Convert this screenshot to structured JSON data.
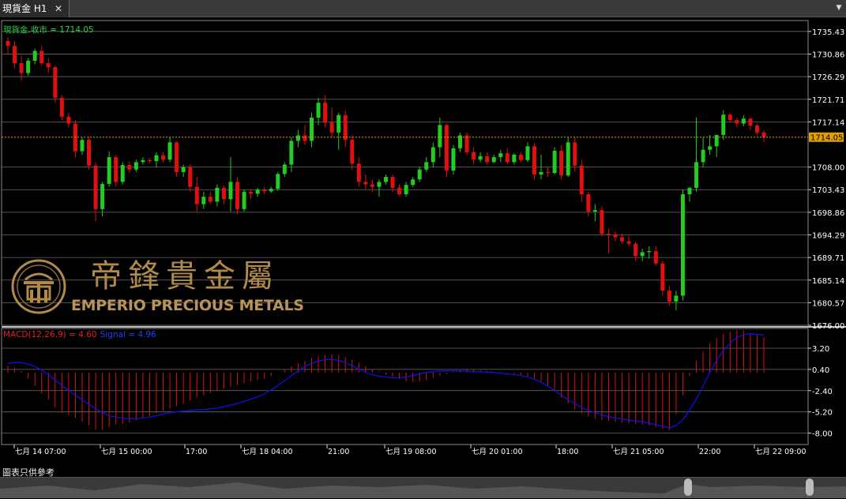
{
  "window": {
    "tab_title": "現貨金 H1",
    "close_glyph": "✕",
    "menu_glyph": "▼"
  },
  "price_panel": {
    "symbol_label": "現貨金,收市 = 1714.05",
    "current_price": "1714.05",
    "y_ticks": [
      "1735.43",
      "1730.86",
      "1726.29",
      "1721.71",
      "1717.14",
      "1708.00",
      "1703.43",
      "1698.86",
      "1694.29",
      "1689.71",
      "1685.14",
      "1680.57",
      "1676.00"
    ]
  },
  "macd_panel": {
    "macd_label": "MACD(12,26,9) = 4.60",
    "signal_label": "Signal = 4.96",
    "y_ticks": [
      "3.20",
      "0.40",
      "-2.40",
      "-5.20",
      "-8.00"
    ]
  },
  "x_ticks": [
    "七月 14 07:00",
    "七月 15 00:00",
    "17:00",
    "七月 18 04:00",
    "21:00",
    "七月 19 08:00",
    "七月 20 01:00",
    "18:00",
    "七月 21 05:00",
    "22:00",
    "七月 22 09:00"
  ],
  "logo": {
    "cn": "帝鋒貴金屬",
    "en": "EMPERIO PRECIOUS METALS"
  },
  "footer": {
    "label": "圖表只供參考"
  },
  "colors": {
    "up": "#22cc22",
    "down": "#e01010",
    "grid": "#6b6b6b",
    "axis_text": "#ffffff",
    "price_line": "#e0a000",
    "signal": "#1010e0",
    "hist": "#e01010",
    "logo_gold": "#b08a4a"
  },
  "chart_data": {
    "type": "candlestick",
    "title": "現貨金 H1",
    "close": 1714.05,
    "ylim": [
      1676.0,
      1737.0
    ],
    "candles": [
      [
        1733.5,
        1734.2,
        1731.0,
        1732.5
      ],
      [
        1732.5,
        1733.5,
        1728.0,
        1729.0
      ],
      [
        1729.0,
        1730.5,
        1725.5,
        1727.0
      ],
      [
        1727.0,
        1730.0,
        1726.5,
        1729.5
      ],
      [
        1729.5,
        1732.0,
        1728.8,
        1731.5
      ],
      [
        1731.5,
        1732.5,
        1728.5,
        1729.0
      ],
      [
        1729.0,
        1730.0,
        1727.0,
        1728.2
      ],
      [
        1728.2,
        1728.5,
        1721.0,
        1722.0
      ],
      [
        1722.0,
        1722.5,
        1717.5,
        1718.2
      ],
      [
        1718.2,
        1719.0,
        1716.0,
        1716.8
      ],
      [
        1716.8,
        1717.5,
        1710.0,
        1711.2
      ],
      [
        1711.2,
        1714.0,
        1710.5,
        1713.5
      ],
      [
        1713.5,
        1714.2,
        1707.5,
        1708.3
      ],
      [
        1708.3,
        1709.0,
        1697.0,
        1699.5
      ],
      [
        1699.5,
        1705.0,
        1698.0,
        1704.6
      ],
      [
        1704.6,
        1711.2,
        1704.0,
        1710.0
      ],
      [
        1710.0,
        1710.5,
        1704.0,
        1705.0
      ],
      [
        1705.0,
        1709.0,
        1704.5,
        1708.4
      ],
      [
        1708.4,
        1709.2,
        1706.8,
        1707.5
      ],
      [
        1707.5,
        1709.5,
        1707.0,
        1709.0
      ],
      [
        1709.0,
        1710.0,
        1708.5,
        1709.4
      ],
      [
        1709.4,
        1709.8,
        1708.8,
        1709.2
      ],
      [
        1709.2,
        1711.0,
        1708.0,
        1710.4
      ],
      [
        1710.4,
        1711.0,
        1709.0,
        1709.5
      ],
      [
        1709.5,
        1714.0,
        1709.0,
        1713.0
      ],
      [
        1713.0,
        1713.2,
        1706.0,
        1707.0
      ],
      [
        1707.0,
        1708.5,
        1706.0,
        1708.0
      ],
      [
        1708.0,
        1708.5,
        1703.0,
        1704.0
      ],
      [
        1704.0,
        1706.0,
        1699.0,
        1700.5
      ],
      [
        1700.5,
        1703.0,
        1699.5,
        1702.0
      ],
      [
        1702.0,
        1703.0,
        1700.5,
        1701.0
      ],
      [
        1701.0,
        1704.5,
        1700.0,
        1703.8
      ],
      [
        1703.8,
        1704.2,
        1700.5,
        1701.5
      ],
      [
        1701.5,
        1710.0,
        1699.0,
        1705.0
      ],
      [
        1705.0,
        1706.0,
        1698.5,
        1699.5
      ],
      [
        1699.5,
        1703.5,
        1699.0,
        1703.0
      ],
      [
        1703.0,
        1703.6,
        1701.5,
        1702.6
      ],
      [
        1702.6,
        1703.8,
        1702.0,
        1703.4
      ],
      [
        1703.4,
        1704.0,
        1702.5,
        1703.1
      ],
      [
        1703.1,
        1704.0,
        1702.8,
        1703.6
      ],
      [
        1703.6,
        1707.0,
        1703.2,
        1706.6
      ],
      [
        1706.6,
        1709.0,
        1706.0,
        1708.5
      ],
      [
        1708.5,
        1714.0,
        1707.0,
        1713.3
      ],
      [
        1713.3,
        1715.5,
        1712.0,
        1714.4
      ],
      [
        1714.4,
        1716.5,
        1712.5,
        1713.3
      ],
      [
        1713.3,
        1719.0,
        1712.0,
        1718.0
      ],
      [
        1718.0,
        1722.0,
        1716.5,
        1721.0
      ],
      [
        1721.0,
        1722.5,
        1716.0,
        1717.0
      ],
      [
        1717.0,
        1720.0,
        1714.0,
        1715.0
      ],
      [
        1715.0,
        1719.0,
        1711.5,
        1718.5
      ],
      [
        1718.5,
        1719.5,
        1712.0,
        1713.5
      ],
      [
        1713.5,
        1714.5,
        1707.5,
        1708.7
      ],
      [
        1708.7,
        1710.0,
        1704.0,
        1705.0
      ],
      [
        1705.0,
        1706.5,
        1703.5,
        1704.5
      ],
      [
        1704.5,
        1705.5,
        1703.0,
        1704.0
      ],
      [
        1704.0,
        1705.5,
        1702.0,
        1705.0
      ],
      [
        1705.0,
        1706.5,
        1704.5,
        1706.0
      ],
      [
        1706.0,
        1706.5,
        1703.0,
        1703.8
      ],
      [
        1703.8,
        1704.5,
        1702.0,
        1702.5
      ],
      [
        1702.5,
        1705.0,
        1702.0,
        1704.4
      ],
      [
        1704.4,
        1706.0,
        1704.0,
        1705.5
      ],
      [
        1705.5,
        1708.0,
        1705.0,
        1707.5
      ],
      [
        1707.5,
        1710.0,
        1707.0,
        1709.0
      ],
      [
        1709.0,
        1713.0,
        1708.0,
        1712.0
      ],
      [
        1712.0,
        1718.0,
        1710.0,
        1716.5
      ],
      [
        1716.5,
        1716.8,
        1706.0,
        1707.3
      ],
      [
        1707.3,
        1712.5,
        1706.5,
        1711.8
      ],
      [
        1711.8,
        1715.0,
        1711.0,
        1714.4
      ],
      [
        1714.4,
        1715.0,
        1710.5,
        1711.0
      ],
      [
        1711.0,
        1712.0,
        1708.5,
        1709.5
      ],
      [
        1709.5,
        1711.0,
        1709.0,
        1710.2
      ],
      [
        1710.2,
        1711.0,
        1708.5,
        1709.0
      ],
      [
        1709.0,
        1710.5,
        1708.8,
        1710.0
      ],
      [
        1710.0,
        1711.5,
        1709.0,
        1710.8
      ],
      [
        1710.8,
        1711.8,
        1708.5,
        1709.0
      ],
      [
        1709.0,
        1710.8,
        1708.5,
        1710.5
      ],
      [
        1710.5,
        1711.0,
        1709.0,
        1709.4
      ],
      [
        1709.4,
        1713.0,
        1709.0,
        1712.2
      ],
      [
        1712.2,
        1712.8,
        1705.5,
        1706.5
      ],
      [
        1706.5,
        1710.5,
        1705.5,
        1707.0
      ],
      [
        1707.0,
        1708.0,
        1706.0,
        1706.8
      ],
      [
        1706.8,
        1712.0,
        1706.5,
        1711.3
      ],
      [
        1711.3,
        1712.5,
        1705.5,
        1706.3
      ],
      [
        1706.3,
        1714.0,
        1706.0,
        1713.0
      ],
      [
        1713.0,
        1714.0,
        1707.0,
        1708.3
      ],
      [
        1708.3,
        1709.5,
        1701.0,
        1702.5
      ],
      [
        1702.5,
        1703.0,
        1698.0,
        1699.0
      ],
      [
        1699.0,
        1700.5,
        1697.0,
        1699.3
      ],
      [
        1699.3,
        1700.0,
        1694.0,
        1694.5
      ],
      [
        1694.5,
        1695.5,
        1690.5,
        1694.4
      ],
      [
        1694.4,
        1695.0,
        1693.0,
        1693.8
      ],
      [
        1693.8,
        1694.5,
        1692.5,
        1693.0
      ],
      [
        1693.0,
        1694.0,
        1692.0,
        1692.5
      ],
      [
        1692.5,
        1692.8,
        1689.0,
        1690.0
      ],
      [
        1690.0,
        1691.5,
        1689.0,
        1690.8
      ],
      [
        1690.8,
        1692.0,
        1689.5,
        1691.0
      ],
      [
        1691.0,
        1692.0,
        1688.0,
        1688.5
      ],
      [
        1688.5,
        1689.0,
        1682.0,
        1683.0
      ],
      [
        1683.0,
        1684.0,
        1680.0,
        1680.8
      ],
      [
        1680.8,
        1683.0,
        1679.0,
        1682.0
      ],
      [
        1682.0,
        1703.5,
        1681.0,
        1702.5
      ],
      [
        1702.5,
        1704.0,
        1701.0,
        1703.8
      ],
      [
        1703.8,
        1718.0,
        1703.0,
        1709.0
      ],
      [
        1709.0,
        1714.0,
        1708.0,
        1711.5
      ],
      [
        1711.5,
        1714.5,
        1710.5,
        1712.2
      ],
      [
        1712.2,
        1713.0,
        1710.0,
        1714.5
      ],
      [
        1714.5,
        1719.5,
        1713.5,
        1718.6
      ],
      [
        1718.6,
        1719.0,
        1717.0,
        1717.5
      ],
      [
        1717.5,
        1718.0,
        1716.0,
        1716.8
      ],
      [
        1716.8,
        1718.5,
        1716.2,
        1717.8
      ],
      [
        1717.8,
        1718.0,
        1715.5,
        1716.4
      ],
      [
        1716.4,
        1716.8,
        1714.5,
        1715.0
      ],
      [
        1715.0,
        1715.5,
        1713.0,
        1714.05
      ]
    ],
    "macd_histogram": [
      0.9,
      0.6,
      0.2,
      -0.8,
      -1.8,
      -2.8,
      -3.6,
      -4.6,
      -5.3,
      -5.6,
      -6.0,
      -6.5,
      -7.0,
      -7.5,
      -7.6,
      -7.2,
      -6.9,
      -6.8,
      -6.6,
      -6.3,
      -6.0,
      -5.7,
      -5.4,
      -5.1,
      -4.8,
      -4.5,
      -4.1,
      -3.7,
      -3.3,
      -3.0,
      -2.7,
      -2.4,
      -2.1,
      -1.9,
      -1.6,
      -1.4,
      -1.2,
      -1.0,
      -0.8,
      -0.5,
      0.0,
      0.4,
      0.8,
      1.2,
      1.5,
      1.9,
      2.1,
      2.3,
      2.4,
      2.3,
      2.0,
      1.7,
      1.3,
      0.8,
      0.4,
      0.1,
      -0.3,
      -0.6,
      -0.9,
      -1.2,
      -1.3,
      -1.2,
      -1.0,
      -0.7,
      -0.4,
      -0.2,
      0.1,
      0.3,
      0.4,
      0.4,
      0.3,
      0.2,
      0.1,
      0.0,
      -0.1,
      -0.2,
      -0.3,
      -0.5,
      -0.8,
      -1.2,
      -1.8,
      -2.5,
      -3.3,
      -4.1,
      -4.9,
      -5.4,
      -5.8,
      -6.1,
      -6.3,
      -6.4,
      -6.5,
      -6.6,
      -6.7,
      -6.8,
      -6.9,
      -7.0,
      -7.2,
      -7.4,
      -7.6,
      -5.5,
      -3.0,
      -0.5,
      1.5,
      2.8,
      3.8,
      4.6,
      5.1,
      5.4,
      5.6,
      5.5,
      5.2,
      4.9,
      4.6
    ],
    "signal_line": [
      1.2,
      1.3,
      1.3,
      1.1,
      0.8,
      0.3,
      -0.3,
      -1.0,
      -1.7,
      -2.4,
      -3.0,
      -3.6,
      -4.2,
      -4.8,
      -5.3,
      -5.7,
      -5.9,
      -6.0,
      -6.1,
      -6.1,
      -6.0,
      -5.9,
      -5.7,
      -5.5,
      -5.3,
      -5.2,
      -5.1,
      -5.0,
      -4.9,
      -4.9,
      -4.8,
      -4.7,
      -4.5,
      -4.3,
      -4.1,
      -3.8,
      -3.5,
      -3.2,
      -2.8,
      -2.3,
      -1.7,
      -1.1,
      -0.4,
      0.2,
      0.8,
      1.2,
      1.5,
      1.7,
      1.7,
      1.6,
      1.3,
      0.9,
      0.4,
      0.0,
      -0.3,
      -0.5,
      -0.6,
      -0.7,
      -0.7,
      -0.6,
      -0.4,
      -0.2,
      0.0,
      0.1,
      0.2,
      0.2,
      0.2,
      0.2,
      0.2,
      0.1,
      0.1,
      0.0,
      0.0,
      -0.1,
      -0.2,
      -0.3,
      -0.4,
      -0.6,
      -0.9,
      -1.3,
      -1.8,
      -2.4,
      -3.0,
      -3.6,
      -4.1,
      -4.6,
      -5.0,
      -5.3,
      -5.6,
      -5.8,
      -6.0,
      -6.1,
      -6.3,
      -6.4,
      -6.5,
      -6.7,
      -6.9,
      -7.1,
      -7.3,
      -7.0,
      -6.2,
      -5.0,
      -3.5,
      -1.8,
      0.0,
      1.6,
      2.9,
      3.9,
      4.6,
      5.0,
      5.1,
      5.0,
      4.96
    ]
  }
}
